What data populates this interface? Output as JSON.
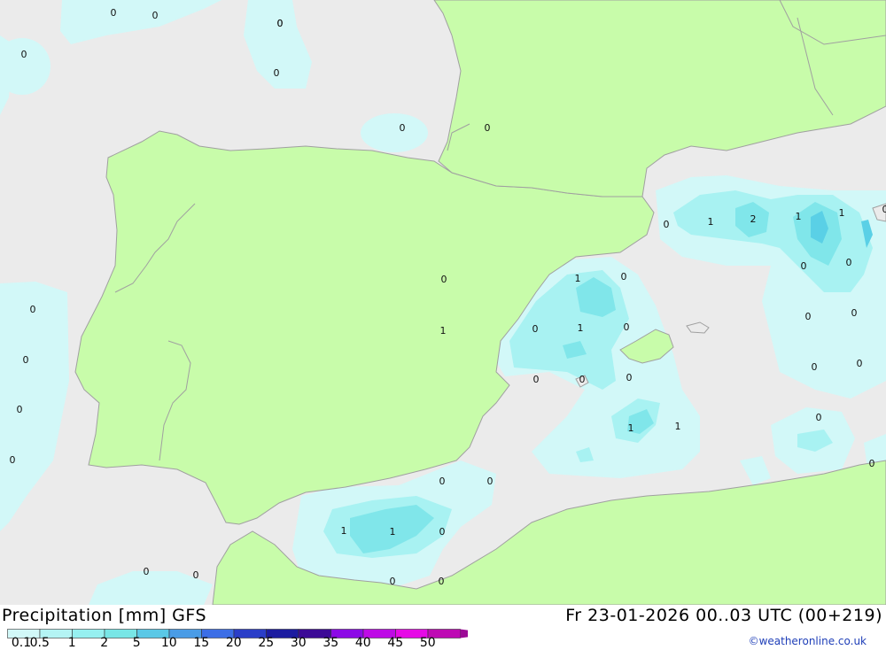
{
  "header": {
    "left_title": "Precipitation [mm] GFS",
    "right_title": "Fr 23-01-2026 00..03 UTC (00+219)"
  },
  "legend": {
    "levels": [
      "0.1",
      "0.5",
      "1",
      "2",
      "5",
      "10",
      "15",
      "20",
      "25",
      "30",
      "35",
      "40",
      "45",
      "50"
    ],
    "colors": [
      "#d2f8f8",
      "#b4f4f4",
      "#96f0f0",
      "#78e6e6",
      "#5ac8e6",
      "#4a9ce6",
      "#3c6ee6",
      "#2a3ec8",
      "#1c1ca0",
      "#3c0a96",
      "#8c0ae6",
      "#be0ae6",
      "#e60ae6",
      "#be0ab4",
      "#9c0a96"
    ]
  },
  "map": {
    "colors": {
      "sea": "#ebebeb",
      "land": "#c8fcaa",
      "precip_light": "#d2f8f8",
      "precip_1": "#a8f2f2",
      "precip_2": "#80e6ea",
      "precip_5": "#5ad0e6",
      "border": "#a0a0a0"
    },
    "value_labels": [
      "0",
      "0",
      "0",
      "0",
      "0",
      "0",
      "0",
      "0",
      "0",
      "1",
      "2",
      "1",
      "1",
      "0",
      "0",
      "0",
      "0",
      "1",
      "0",
      "0",
      "1",
      "0",
      "0",
      "1",
      "0",
      "0",
      "0",
      "0",
      "0",
      "0",
      "0",
      "0",
      "1",
      "1",
      "0",
      "0",
      "0",
      "0",
      "0",
      "0",
      "1",
      "1",
      "0",
      "0",
      "0",
      "0",
      "0"
    ]
  },
  "credit": "©weatheronline.co.uk"
}
